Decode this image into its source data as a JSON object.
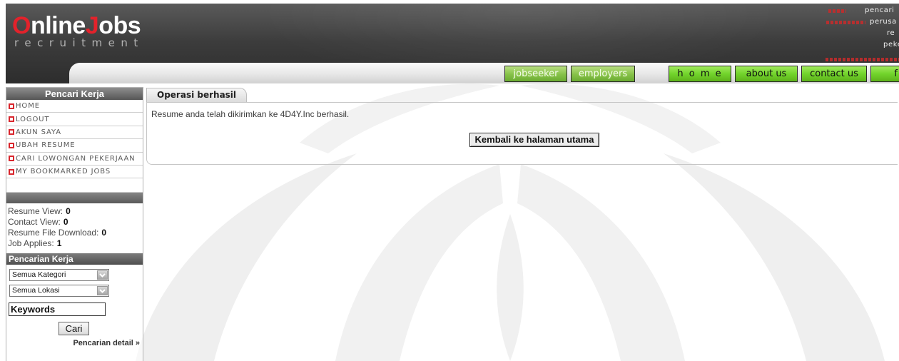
{
  "header": {
    "logo": {
      "letter_o": "O",
      "rest_1": "nline",
      "letter_j": "J",
      "rest_2": "obs",
      "tagline": "recruitment"
    },
    "corner_text": {
      "line_1": "pencari",
      "line_2": "perusa",
      "line_3": "re",
      "line_4": "peke"
    },
    "nav": {
      "jobseeker": "jobseeker",
      "employers": "employers",
      "home": "h o m e",
      "about": "about us",
      "contact": "contact us",
      "more": "f"
    }
  },
  "sidebar": {
    "title": "Pencari Kerja",
    "menu": [
      {
        "label": "HOME"
      },
      {
        "label": "LOGOUT"
      },
      {
        "label": "AKUN SAYA"
      },
      {
        "label": "UBAH RESUME"
      },
      {
        "label": "CARI LOWONGAN PEKERJAAN"
      },
      {
        "label": "MY BOOKMARKED JOBS"
      }
    ],
    "stats": [
      {
        "label": "Resume View:",
        "value": "0"
      },
      {
        "label": "Contact View:",
        "value": "0"
      },
      {
        "label": "Resume File Download:",
        "value": "0"
      },
      {
        "label": "Job Applies:",
        "value": "1"
      }
    ],
    "search": {
      "title": "Pencarian Kerja",
      "category_select": "Semua Kategori",
      "location_select": "Semua Lokasi",
      "keywords_value": "Keywords",
      "submit_label": "Cari",
      "detail_link": "Pencarian detail »"
    }
  },
  "main": {
    "tab_title": "Operasi berhasil",
    "message": "Resume anda telah dikirimkan ke 4D4Y.Inc berhasil.",
    "back_button": "Kembali ke halaman utama"
  },
  "icons": {
    "menu_bullet": "square-bullet",
    "select_arrow": "chevron-down"
  },
  "colors": {
    "brand_red": "#e3222b",
    "bullet_red": "#d9272e",
    "nav_green": "#5db21a",
    "header_dark": "#333333"
  }
}
